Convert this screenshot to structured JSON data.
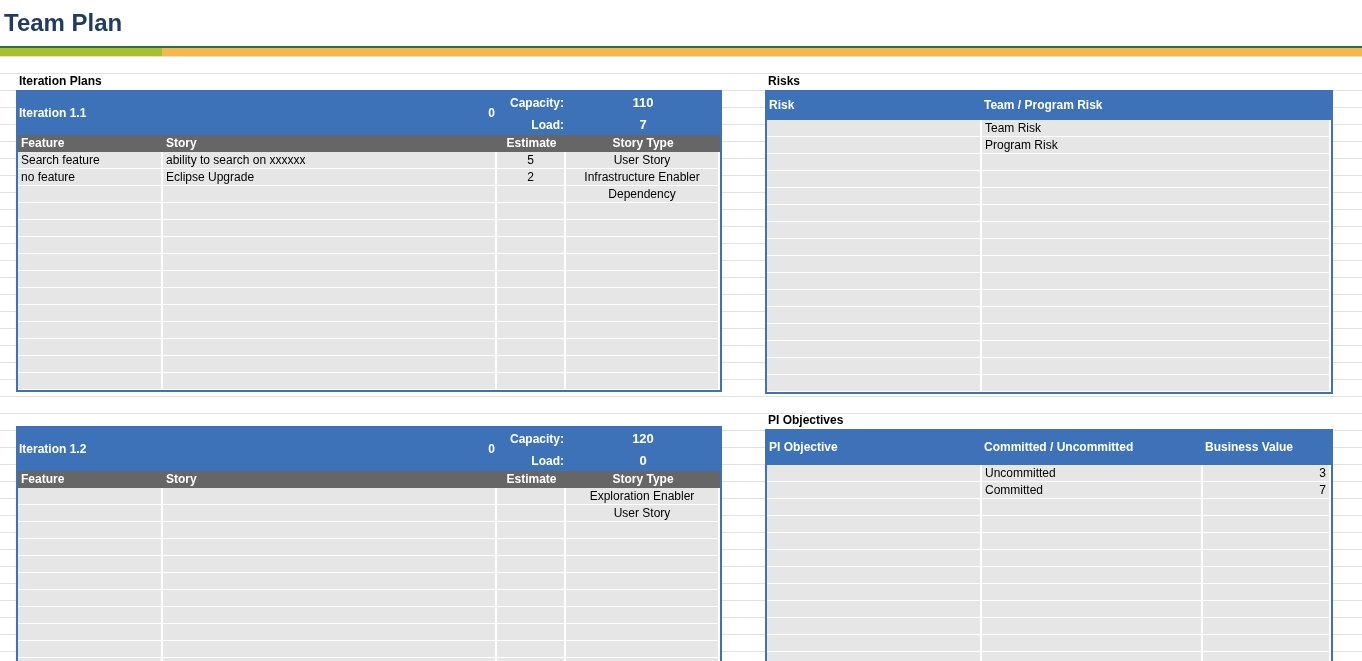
{
  "title": "Team Plan",
  "iteration_plans": {
    "label": "Iteration Plans",
    "iterations": [
      {
        "name": "Iteration 1.1",
        "total": "0",
        "capacity_label": "Capacity:",
        "capacity": "110",
        "load_label": "Load:",
        "load": "7",
        "columns": [
          "Feature",
          "Story",
          "Estimate",
          "Story Type"
        ],
        "rows": [
          {
            "feature": "Search feature",
            "story": "ability to search on xxxxxx",
            "estimate": "5",
            "story_type": "User Story"
          },
          {
            "feature": "no feature",
            "story": "Eclipse Upgrade",
            "estimate": "2",
            "story_type": "Infrastructure Enabler"
          },
          {
            "story_type": "Dependency"
          }
        ]
      },
      {
        "name": "Iteration 1.2",
        "total": "0",
        "capacity_label": "Capacity:",
        "capacity": "120",
        "load_label": "Load:",
        "load": "0",
        "columns": [
          "Feature",
          "Story",
          "Estimate",
          "Story Type"
        ],
        "rows": [
          {
            "story_type": "Exploration Enabler"
          },
          {
            "story_type": "User Story"
          }
        ]
      }
    ]
  },
  "risks": {
    "label": "Risks",
    "columns": [
      "Risk",
      "Team / Program Risk"
    ],
    "rows": [
      {
        "team_program_risk": "Team Risk"
      },
      {
        "team_program_risk": "Program Risk"
      }
    ]
  },
  "pi_objectives": {
    "label": "PI Objectives",
    "columns": [
      "PI Objective",
      "Committed / Uncommitted",
      "Business Value"
    ],
    "rows": [
      {
        "commitment": "Uncommitted",
        "business_value": "3"
      },
      {
        "commitment": "Committed",
        "business_value": "7"
      }
    ]
  }
}
